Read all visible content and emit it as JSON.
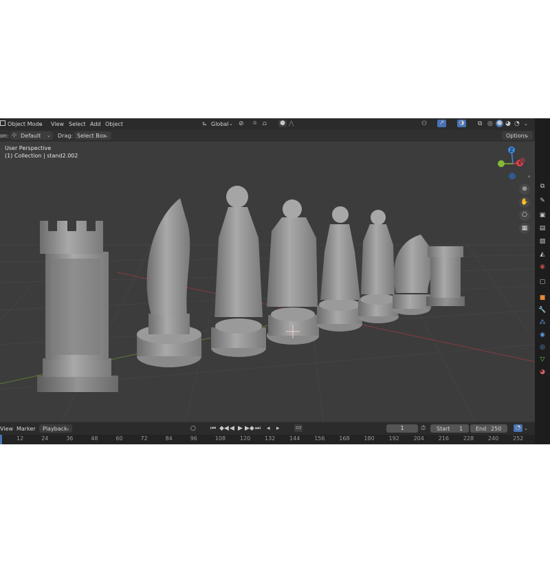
{
  "header": {
    "mode_label": "Object Mode",
    "menu": [
      "View",
      "Select",
      "Add",
      "Object"
    ],
    "transform_orientation": "Global"
  },
  "toolsettings": {
    "orientation_prefix": "on:",
    "orientation_value": "Default",
    "drag_label": "Drag:",
    "drag_value": "Select Box",
    "options_label": "Options"
  },
  "viewport": {
    "perspective_label": "User Perspective",
    "collection_label": "(1) Collection | stand2.002",
    "gizmo_axes": {
      "z": "Z",
      "x": "X"
    }
  },
  "timeline": {
    "menu": [
      "View",
      "Marker",
      "Playback"
    ],
    "current_frame": "1",
    "start_label": "Start",
    "start_value": "1",
    "end_label": "End",
    "end_value": "250",
    "ruler_ticks": [
      "12",
      "24",
      "36",
      "48",
      "60",
      "72",
      "84",
      "96",
      "108",
      "120",
      "132",
      "144",
      "156",
      "168",
      "180",
      "192",
      "204",
      "216",
      "228",
      "240",
      "252"
    ]
  },
  "colors": {
    "axis_x": "#e0424d",
    "axis_y": "#85b83a",
    "axis_z": "#3f87dd",
    "frame_indicator": "#4772b3"
  }
}
